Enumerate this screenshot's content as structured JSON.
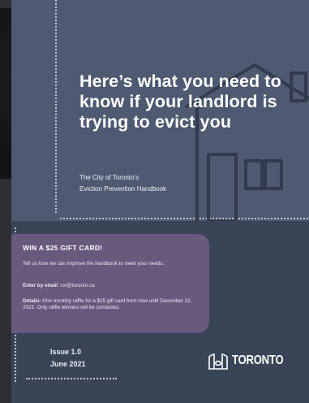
{
  "cover": {
    "title": "Here’s what you need to know if your landlord is trying to evict you",
    "subtitle_line1": "The City of Toronto’s",
    "subtitle_line2": "Eviction Prevention Handbook"
  },
  "promo": {
    "heading": "WIN A $25 GIFT CARD!",
    "intro": "Tell us how we can improve the handbook to meet your needs.",
    "email_label": "Enter by email",
    "email_value": ": cxi@toronto.ca",
    "details_label": "Details",
    "details_value": ": One monthly raffle for a $25 gift card from now until December 31, 2021. Only raffle winners will be contacted."
  },
  "issue": {
    "number": "Issue 1.0",
    "date": "June 2021"
  },
  "logo": {
    "wordmark": "TORONTO",
    "icon": "city-hall-icon"
  },
  "colors": {
    "cover_top": "#4e5a72",
    "cover_bottom": "#3a4457",
    "promo_bg": "#675a7d",
    "text": "#ffffff"
  }
}
